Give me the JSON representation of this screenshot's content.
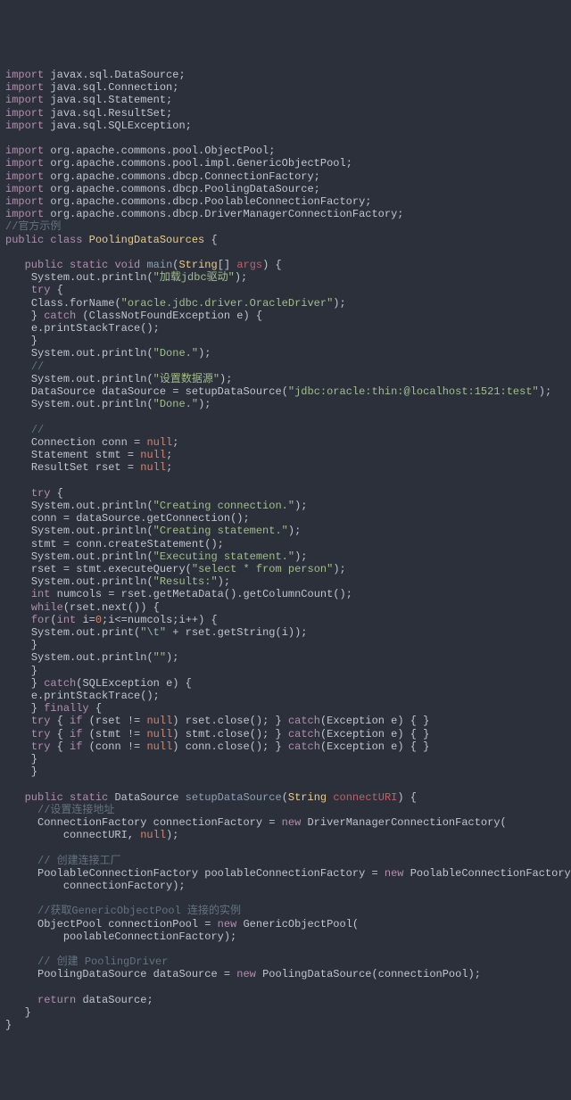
{
  "imports": {
    "l1": "javax.sql.DataSource",
    "l2": "java.sql.Connection",
    "l3": "java.sql.Statement",
    "l4": "java.sql.ResultSet",
    "l5": "java.sql.SQLException",
    "l6": "org.apache.commons.pool.ObjectPool",
    "l7": "org.apache.commons.pool.impl.GenericObjectPool",
    "l8": "org.apache.commons.dbcp.ConnectionFactory",
    "l9": "org.apache.commons.dbcp.PoolingDataSource",
    "l10": "org.apache.commons.dbcp.PoolableConnectionFactory",
    "l11": "org.apache.commons.dbcp.DriverManagerConnectionFactory"
  },
  "comments": {
    "officialExample": "//官方示例",
    "slashes": "//",
    "setConnAddr": "//设置连接地址",
    "createConnFactory": "// 创建连接工厂",
    "getPoolInstance": "//获取GenericObjectPool 连接的实例",
    "createPoolingDriver": "// 创建 PoolingDriver"
  },
  "strings": {
    "loadJdbc": "\"加载jdbc驱动\"",
    "oracleDriver": "\"oracle.jdbc.driver.OracleDriver\"",
    "done": "\"Done.\"",
    "setDataSource": "\"设置数据源\"",
    "jdbcUrl": "\"jdbc:oracle:thin:@localhost:1521:test\"",
    "creatingConnection": "\"Creating connection.\"",
    "creatingStatement": "\"Creating statement.\"",
    "executingStatement": "\"Executing statement.\"",
    "selectPerson": "\"select * from person\"",
    "results": "\"Results:\"",
    "tab": "\\t",
    "tabQ1": "\"",
    "tabQ2": "\"",
    "empty": "\"\""
  },
  "kw": {
    "import": "import",
    "public": "public",
    "class": "class",
    "static": "static",
    "void": "void",
    "try": "try",
    "catch": "catch",
    "for": "for",
    "while": "while",
    "if": "if",
    "return": "return",
    "new": "new",
    "finally": "finally",
    "int": "int",
    "null": "null"
  },
  "id": {
    "className": "PoolingDataSources",
    "main": "main",
    "args": "args",
    "String": "String",
    "system_out_println": "System.out.println",
    "system_out_print": "System.out.print",
    "Class_forName": "Class.forName",
    "ClassNotFoundException": "ClassNotFoundException",
    "e": "e",
    "e_printStackTrace": "e.printStackTrace",
    "DataSource": "DataSource",
    "dataSource": "dataSource",
    "setupDataSource": "setupDataSource",
    "Connection": "Connection",
    "conn": "conn",
    "Statement": "Statement",
    "stmt": "stmt",
    "ResultSet": "ResultSet",
    "rset": "rset",
    "getConnection": "getConnection",
    "createStatement": "createStatement",
    "executeQuery": "executeQuery",
    "numcols": "numcols",
    "getMetaData": "getMetaData",
    "getColumnCount": "getColumnCount",
    "next": "next",
    "i": "i",
    "zero": "0",
    "getString": "getString",
    "SQLException": "SQLException",
    "close": "close",
    "Exception": "Exception",
    "connectURI": "connectURI",
    "ConnectionFactory": "ConnectionFactory",
    "connectionFactory": "connectionFactory",
    "DriverManagerConnectionFactory": "DriverManagerConnectionFactory",
    "PoolableConnectionFactory": "PoolableConnectionFactory",
    "poolableConnectionFactory": "poolableConnectionFactory",
    "ObjectPool": "ObjectPool",
    "connectionPool": "connectionPool",
    "GenericObjectPool": "GenericObjectPool",
    "PoolingDataSource": "PoolingDataSource"
  }
}
